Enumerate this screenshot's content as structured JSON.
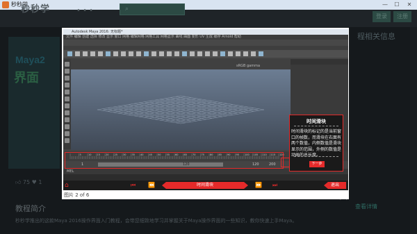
{
  "window": {
    "title": "秒秒学"
  },
  "site": {
    "logo": "秒秒学",
    "login": "登录",
    "register": "注册",
    "side_title": "程相关信息",
    "thumb_text_1": "Maya2",
    "thumb_text_2": "界面",
    "like_count": "75",
    "fav_count": "1",
    "intro_heading": "教程简介",
    "intro_desc": "秒秒学推出的这款Maya 2016操作界面入门教程，会带您细致地学习并掌握关于Maya操作界面的一些知识，教你快速上手Maya。",
    "detail_link": "查看详情"
  },
  "lightbox": {
    "caption": "图片 2 of 6",
    "close": "✕"
  },
  "maya": {
    "title": "Autodesk Maya 2016: 无标题*",
    "menu": "文件  编辑  创建  选择  修改  显示  窗口  网格  编辑网格  网格工具  网格显示  曲线  曲面  变形  UV  生成  缓存  Arnold  帮助",
    "mel_label": "MEL",
    "timeline_start": "1",
    "timeline_end": "120",
    "range_start": "1",
    "range_mid": "120",
    "range_end": "120",
    "range_max": "200",
    "gamma": "sRGB gamma",
    "ruler_values": [
      "5",
      "10",
      "15",
      "20",
      "25",
      "30",
      "35",
      "40",
      "45",
      "50",
      "55",
      "60",
      "65",
      "70",
      "75",
      "80",
      "85",
      "90",
      "95",
      "100",
      "105",
      "110",
      "115",
      "120"
    ]
  },
  "tooltip": {
    "title": "时间滑块",
    "body": "时间滑块的标记的是当前窗口的帧数，而滑块在右面有两个数值，内侧数值是滑块显示的范围，外侧的数值是动画的总长度。",
    "next_label": "下一步"
  },
  "nav": {
    "step_label": "时间滑块",
    "exit_label": "退出"
  },
  "colors": {
    "accent": "#e52a2a",
    "maya_bg": "#444444",
    "overlay_bg": "#0e1114"
  }
}
